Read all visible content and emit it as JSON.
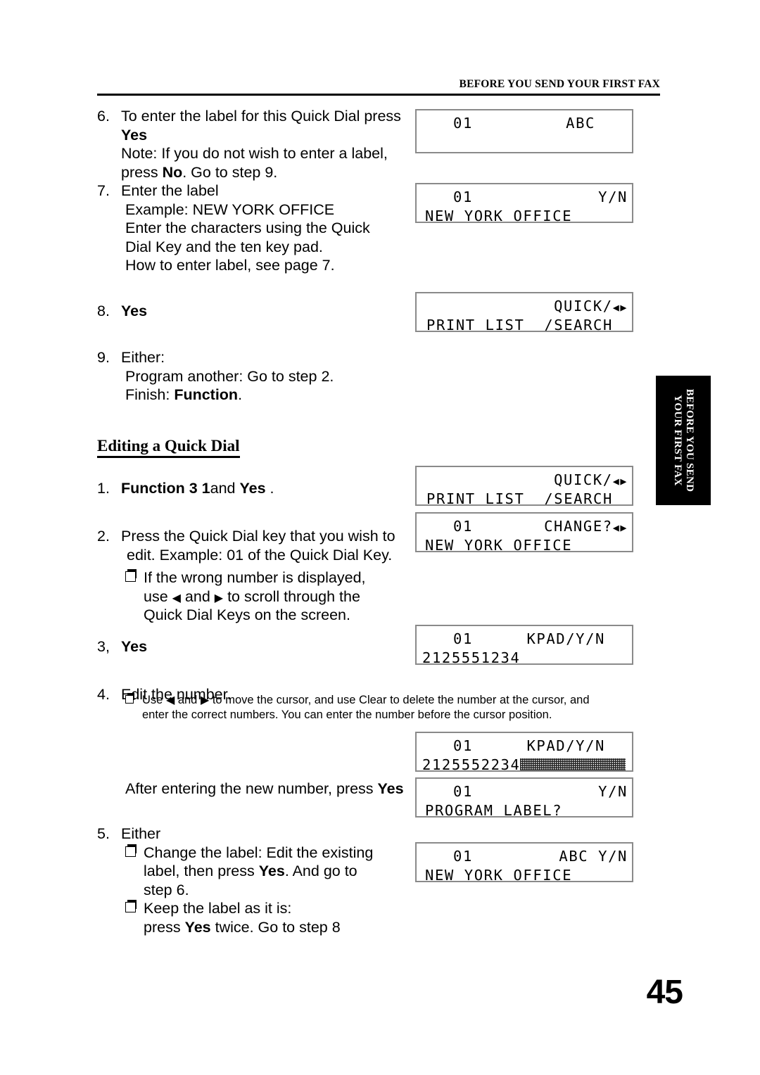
{
  "header": {
    "running_title": "BEFORE YOU SEND YOUR FIRST FAX"
  },
  "side_tab": {
    "line1": "BEFORE YOU SEND",
    "line2": "YOUR FIRST FAX"
  },
  "page_number": "45",
  "steps": [
    {
      "id": "step6",
      "num": "6.",
      "line1": "To enter the label for this Quick Dial press",
      "line2_bold": "Yes",
      "note_line1": "Note: If you do not wish to enter a label,",
      "note_line2_pre": "press ",
      "note_line2_bold": "No",
      "note_line2_post": ". Go to step 9."
    },
    {
      "id": "step7",
      "num": "7.",
      "line1": "Enter the label",
      "sub1": "Example: NEW YORK OFFICE",
      "sub2": "Enter the characters using the Quick",
      "sub3": "Dial Key and the ten key pad.",
      "sub4": "How to enter label, see page 7."
    },
    {
      "id": "step8",
      "num": "8.",
      "bold": "Yes"
    },
    {
      "id": "step9",
      "num": "9.",
      "line1": "Either:",
      "sub1": "Program another: Go to step 2.",
      "sub2_pre": "Finish: ",
      "sub2_bold": "Function",
      "sub2_post": "."
    }
  ],
  "section": {
    "heading": "Editing a Quick Dial",
    "steps": [
      {
        "id": "edit1",
        "num": "1.",
        "bold1": "Function 3 1",
        "mid": "and ",
        "bold2": "Yes",
        "post": " ."
      },
      {
        "id": "edit2",
        "num": "2.",
        "line1": "Press the Quick Dial key that you wish to",
        "line2": "edit. Example: 01 of the Quick Dial Key.",
        "bullet_line1_pre": "If the wrong number is displayed,",
        "bullet_line2_pre": "use ",
        "bullet_line2_mid": " and ",
        "bullet_line2_post": " to scroll through the",
        "bullet_line3": "Quick Dial Keys on the screen."
      },
      {
        "id": "edit3",
        "num": "3,",
        "bold": "Yes"
      },
      {
        "id": "edit4",
        "num": "4.",
        "line1": "Edit the number.",
        "note_pre": "Use ",
        "note_mid": " and ",
        "note_post": " to move the cursor, and use Clear to delete the number at the cursor, and",
        "note_line2": "enter the correct numbers. You can enter the number before the cursor position.",
        "after_pre": "After entering the new number, press ",
        "after_bold": "Yes"
      },
      {
        "id": "edit5",
        "num": "5.",
        "line1": "Either",
        "b1_l1": "Change the label: Edit the existing",
        "b1_l2_pre": "label, then press ",
        "b1_l2_bold": "Yes",
        "b1_l2_post": ". And go to",
        "b1_l3": "step 6.",
        "b2_l1": "Keep the label as it is:",
        "b2_l2_pre": "press ",
        "b2_l2_bold": "Yes",
        "b2_l2_post": " twice. Go to step 8"
      }
    ]
  },
  "displays": [
    {
      "id": "lcd-abc",
      "row1_right": "ABC",
      "row1_left": "01",
      "row2": ""
    },
    {
      "id": "lcd-newyork-yn",
      "row1_right": "Y/N",
      "row1_left": "01",
      "row2": "NEW YORK OFFICE"
    },
    {
      "id": "lcd-quick-search-1",
      "row1_right": "QUICK/",
      "row2": "PRINT LIST  /SEARCH "
    },
    {
      "id": "lcd-quick-search-2",
      "row1_right": "QUICK/",
      "row2": "PRINT LIST  /SEARCH "
    },
    {
      "id": "lcd-change",
      "row1_right": "CHANGE?",
      "row1_left": "01",
      "row2": "NEW YORK OFFICE"
    },
    {
      "id": "lcd-kpad-old",
      "row1_right": "KPAD/Y/N",
      "row1_left": "01",
      "row2": "2125551234"
    },
    {
      "id": "lcd-kpad-new",
      "row1_right": "KPAD/Y/N",
      "row1_left": "01",
      "row2": "2125552234"
    },
    {
      "id": "lcd-program-label",
      "row1_right": "Y/N",
      "row1_left": "01",
      "row2": "PROGRAM LABEL?"
    },
    {
      "id": "lcd-abc-yn",
      "row1_right": "ABC Y/N",
      "row1_left": "01",
      "row2": "NEW YORK OFFICE"
    }
  ],
  "icons": {
    "left_arrow": "◀",
    "right_arrow": "▶"
  }
}
